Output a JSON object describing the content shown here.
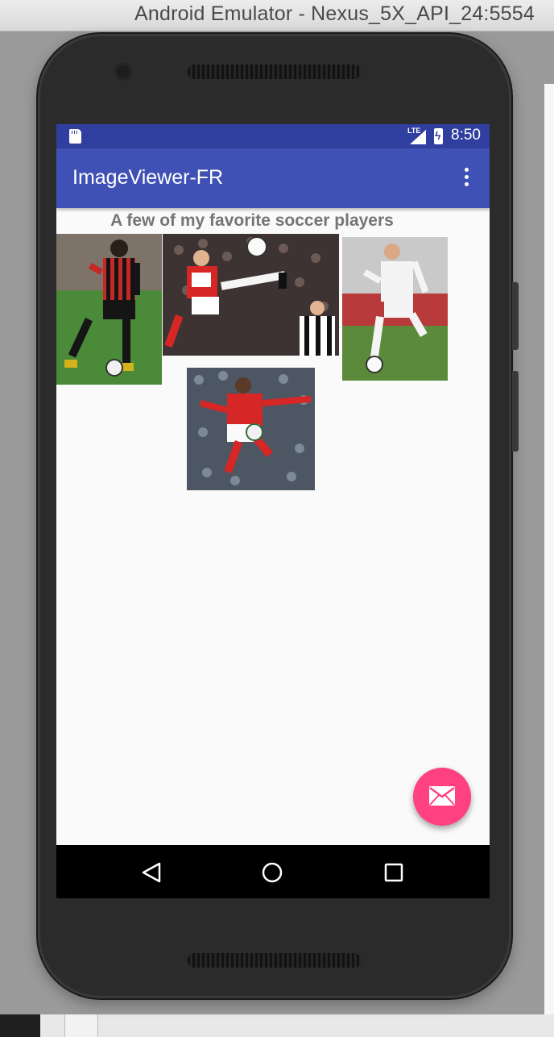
{
  "window": {
    "title": "Android Emulator - Nexus_5X_API_24:5554"
  },
  "statusbar": {
    "network": "LTE",
    "time": "8:50"
  },
  "appbar": {
    "title": "ImageViewer-FR"
  },
  "content": {
    "heading": "A few of my favorite soccer players"
  },
  "colors": {
    "primary": "#3f51b5",
    "primary_dark": "#303f9f",
    "accent": "#ff4081"
  },
  "icons": {
    "fab": "mail-icon",
    "overflow": "more-vert-icon",
    "nav_back": "back-triangle-icon",
    "nav_home": "home-circle-icon",
    "nav_recents": "recents-square-icon"
  }
}
